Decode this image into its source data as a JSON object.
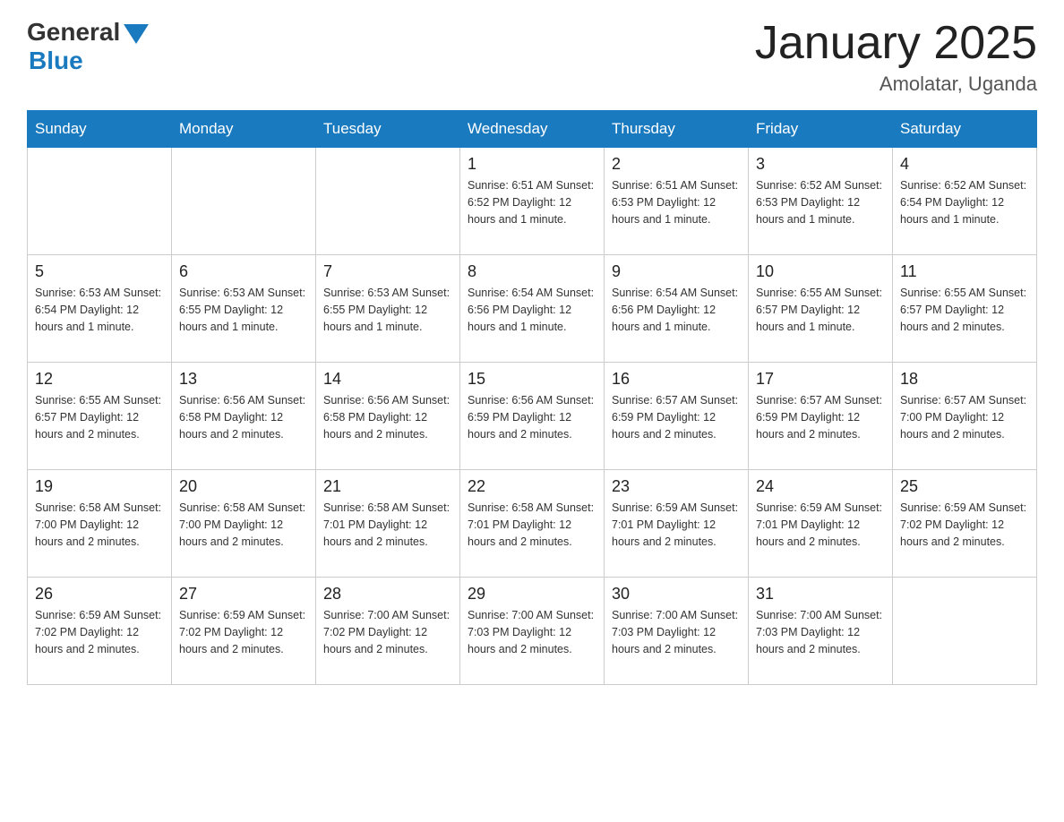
{
  "logo": {
    "general": "General",
    "blue": "Blue"
  },
  "header": {
    "title": "January 2025",
    "subtitle": "Amolatar, Uganda"
  },
  "days_of_week": [
    "Sunday",
    "Monday",
    "Tuesday",
    "Wednesday",
    "Thursday",
    "Friday",
    "Saturday"
  ],
  "weeks": [
    [
      {
        "day": "",
        "info": ""
      },
      {
        "day": "",
        "info": ""
      },
      {
        "day": "",
        "info": ""
      },
      {
        "day": "1",
        "info": "Sunrise: 6:51 AM\nSunset: 6:52 PM\nDaylight: 12 hours and 1 minute."
      },
      {
        "day": "2",
        "info": "Sunrise: 6:51 AM\nSunset: 6:53 PM\nDaylight: 12 hours and 1 minute."
      },
      {
        "day": "3",
        "info": "Sunrise: 6:52 AM\nSunset: 6:53 PM\nDaylight: 12 hours and 1 minute."
      },
      {
        "day": "4",
        "info": "Sunrise: 6:52 AM\nSunset: 6:54 PM\nDaylight: 12 hours and 1 minute."
      }
    ],
    [
      {
        "day": "5",
        "info": "Sunrise: 6:53 AM\nSunset: 6:54 PM\nDaylight: 12 hours and 1 minute."
      },
      {
        "day": "6",
        "info": "Sunrise: 6:53 AM\nSunset: 6:55 PM\nDaylight: 12 hours and 1 minute."
      },
      {
        "day": "7",
        "info": "Sunrise: 6:53 AM\nSunset: 6:55 PM\nDaylight: 12 hours and 1 minute."
      },
      {
        "day": "8",
        "info": "Sunrise: 6:54 AM\nSunset: 6:56 PM\nDaylight: 12 hours and 1 minute."
      },
      {
        "day": "9",
        "info": "Sunrise: 6:54 AM\nSunset: 6:56 PM\nDaylight: 12 hours and 1 minute."
      },
      {
        "day": "10",
        "info": "Sunrise: 6:55 AM\nSunset: 6:57 PM\nDaylight: 12 hours and 1 minute."
      },
      {
        "day": "11",
        "info": "Sunrise: 6:55 AM\nSunset: 6:57 PM\nDaylight: 12 hours and 2 minutes."
      }
    ],
    [
      {
        "day": "12",
        "info": "Sunrise: 6:55 AM\nSunset: 6:57 PM\nDaylight: 12 hours and 2 minutes."
      },
      {
        "day": "13",
        "info": "Sunrise: 6:56 AM\nSunset: 6:58 PM\nDaylight: 12 hours and 2 minutes."
      },
      {
        "day": "14",
        "info": "Sunrise: 6:56 AM\nSunset: 6:58 PM\nDaylight: 12 hours and 2 minutes."
      },
      {
        "day": "15",
        "info": "Sunrise: 6:56 AM\nSunset: 6:59 PM\nDaylight: 12 hours and 2 minutes."
      },
      {
        "day": "16",
        "info": "Sunrise: 6:57 AM\nSunset: 6:59 PM\nDaylight: 12 hours and 2 minutes."
      },
      {
        "day": "17",
        "info": "Sunrise: 6:57 AM\nSunset: 6:59 PM\nDaylight: 12 hours and 2 minutes."
      },
      {
        "day": "18",
        "info": "Sunrise: 6:57 AM\nSunset: 7:00 PM\nDaylight: 12 hours and 2 minutes."
      }
    ],
    [
      {
        "day": "19",
        "info": "Sunrise: 6:58 AM\nSunset: 7:00 PM\nDaylight: 12 hours and 2 minutes."
      },
      {
        "day": "20",
        "info": "Sunrise: 6:58 AM\nSunset: 7:00 PM\nDaylight: 12 hours and 2 minutes."
      },
      {
        "day": "21",
        "info": "Sunrise: 6:58 AM\nSunset: 7:01 PM\nDaylight: 12 hours and 2 minutes."
      },
      {
        "day": "22",
        "info": "Sunrise: 6:58 AM\nSunset: 7:01 PM\nDaylight: 12 hours and 2 minutes."
      },
      {
        "day": "23",
        "info": "Sunrise: 6:59 AM\nSunset: 7:01 PM\nDaylight: 12 hours and 2 minutes."
      },
      {
        "day": "24",
        "info": "Sunrise: 6:59 AM\nSunset: 7:01 PM\nDaylight: 12 hours and 2 minutes."
      },
      {
        "day": "25",
        "info": "Sunrise: 6:59 AM\nSunset: 7:02 PM\nDaylight: 12 hours and 2 minutes."
      }
    ],
    [
      {
        "day": "26",
        "info": "Sunrise: 6:59 AM\nSunset: 7:02 PM\nDaylight: 12 hours and 2 minutes."
      },
      {
        "day": "27",
        "info": "Sunrise: 6:59 AM\nSunset: 7:02 PM\nDaylight: 12 hours and 2 minutes."
      },
      {
        "day": "28",
        "info": "Sunrise: 7:00 AM\nSunset: 7:02 PM\nDaylight: 12 hours and 2 minutes."
      },
      {
        "day": "29",
        "info": "Sunrise: 7:00 AM\nSunset: 7:03 PM\nDaylight: 12 hours and 2 minutes."
      },
      {
        "day": "30",
        "info": "Sunrise: 7:00 AM\nSunset: 7:03 PM\nDaylight: 12 hours and 2 minutes."
      },
      {
        "day": "31",
        "info": "Sunrise: 7:00 AM\nSunset: 7:03 PM\nDaylight: 12 hours and 2 minutes."
      },
      {
        "day": "",
        "info": ""
      }
    ]
  ]
}
